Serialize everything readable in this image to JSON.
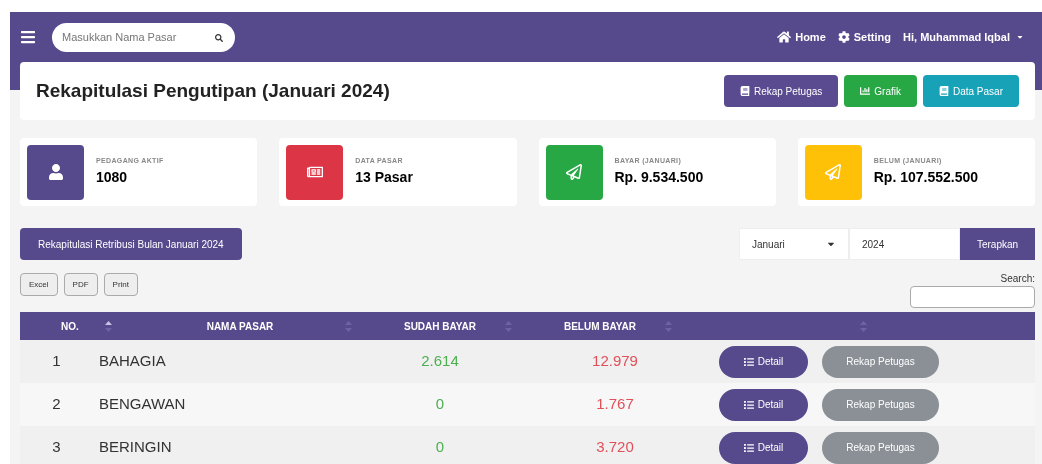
{
  "navbar": {
    "search": {
      "placeholder": "Masukkan Nama Pasar"
    },
    "links": [
      {
        "kind": "home",
        "label": "Home"
      },
      {
        "kind": "setting",
        "label": "Setting"
      },
      {
        "kind": "user",
        "label": "Hi, Muhammad Iqbal"
      }
    ]
  },
  "page": {
    "title": "Rekapitulasi Pengutipan (Januari 2024)",
    "actions": [
      {
        "kind": "rekap",
        "label": "Rekap Petugas",
        "color": "#5a4a8f"
      },
      {
        "kind": "grafik",
        "label": "Grafik",
        "color": "#28a745"
      },
      {
        "kind": "pasar",
        "label": "Data Pasar",
        "color": "#17a2b8"
      }
    ]
  },
  "stats": [
    {
      "kind": "user",
      "label": "PEDAGANG AKTIF",
      "value": "1080",
      "color": "#564a8d"
    },
    {
      "kind": "doc",
      "label": "DATA PASAR",
      "value": "13 Pasar",
      "color": "#dc3545"
    },
    {
      "kind": "send",
      "label": "BAYAR (JANUARI)",
      "value": "Rp. 9.534.500",
      "color": "#28a745"
    },
    {
      "kind": "send",
      "label": "BELUM (JANUARI)",
      "value": "Rp. 107.552.500",
      "color": "#ffc107"
    }
  ],
  "report_button": "Rekapitulasi Retribusi Bulan Januari 2024",
  "filter": {
    "month": "Januari",
    "year": "2024",
    "apply": "Terapkan"
  },
  "export_buttons": [
    "Excel",
    "PDF",
    "Print"
  ],
  "search_label": "Search:",
  "table": {
    "columns": [
      {
        "label": "NO.",
        "sorted": true
      },
      {
        "label": "NAMA PASAR",
        "sorted": false
      },
      {
        "label": "SUDAH BAYAR",
        "sorted": false
      },
      {
        "label": "BELUM BAYAR",
        "sorted": false
      },
      {
        "sorted": false
      }
    ],
    "rows": [
      {
        "no": "1",
        "name": "BAHAGIA",
        "paid": "2.614",
        "unpaid": "12.979",
        "detail": "Detail",
        "rekap": "Rekap Petugas"
      },
      {
        "no": "2",
        "name": "BENGAWAN",
        "paid": "0",
        "unpaid": "1.767",
        "detail": "Detail",
        "rekap": "Rekap Petugas"
      },
      {
        "no": "3",
        "name": "BERINGIN",
        "paid": "0",
        "unpaid": "3.720",
        "detail": "Detail",
        "rekap": "Rekap Petugas"
      }
    ]
  }
}
